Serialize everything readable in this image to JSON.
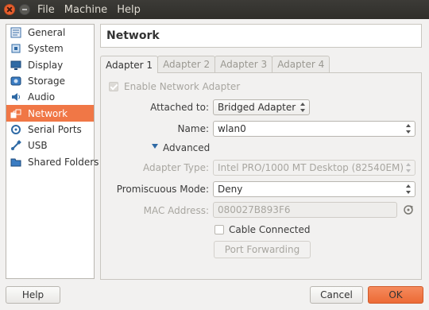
{
  "menubar": {
    "file": "File",
    "machine": "Machine",
    "help": "Help"
  },
  "sidebar": {
    "items": [
      {
        "label": "General",
        "icon": "general-icon"
      },
      {
        "label": "System",
        "icon": "system-icon"
      },
      {
        "label": "Display",
        "icon": "display-icon"
      },
      {
        "label": "Storage",
        "icon": "storage-icon"
      },
      {
        "label": "Audio",
        "icon": "audio-icon"
      },
      {
        "label": "Network",
        "icon": "network-icon",
        "selected": true
      },
      {
        "label": "Serial Ports",
        "icon": "serial-ports-icon"
      },
      {
        "label": "USB",
        "icon": "usb-icon"
      },
      {
        "label": "Shared Folders",
        "icon": "shared-folders-icon"
      }
    ]
  },
  "page": {
    "title": "Network"
  },
  "tabs": [
    {
      "label": "Adapter 1",
      "active": true
    },
    {
      "label": "Adapter 2"
    },
    {
      "label": "Adapter 3"
    },
    {
      "label": "Adapter 4"
    }
  ],
  "form": {
    "enable_label": "Enable Network Adapter",
    "enable_checked": true,
    "attached_label": "Attached to:",
    "attached_value": "Bridged Adapter",
    "name_label": "Name:",
    "name_value": "wlan0",
    "advanced_label": "Advanced",
    "adapter_type_label": "Adapter Type:",
    "adapter_type_value": "Intel PRO/1000 MT Desktop (82540EM)",
    "promiscuous_label": "Promiscuous Mode:",
    "promiscuous_value": "Deny",
    "mac_label": "MAC Address:",
    "mac_value": "080027B893F6",
    "cable_label": "Cable Connected",
    "cable_checked": false,
    "port_forwarding_label": "Port Forwarding"
  },
  "footer": {
    "help_label": "Help",
    "cancel_label": "Cancel",
    "ok_label": "OK"
  },
  "colors": {
    "accent": "#f07746",
    "titlebar": "#3c3b37",
    "window_bg": "#f2f1f0"
  }
}
